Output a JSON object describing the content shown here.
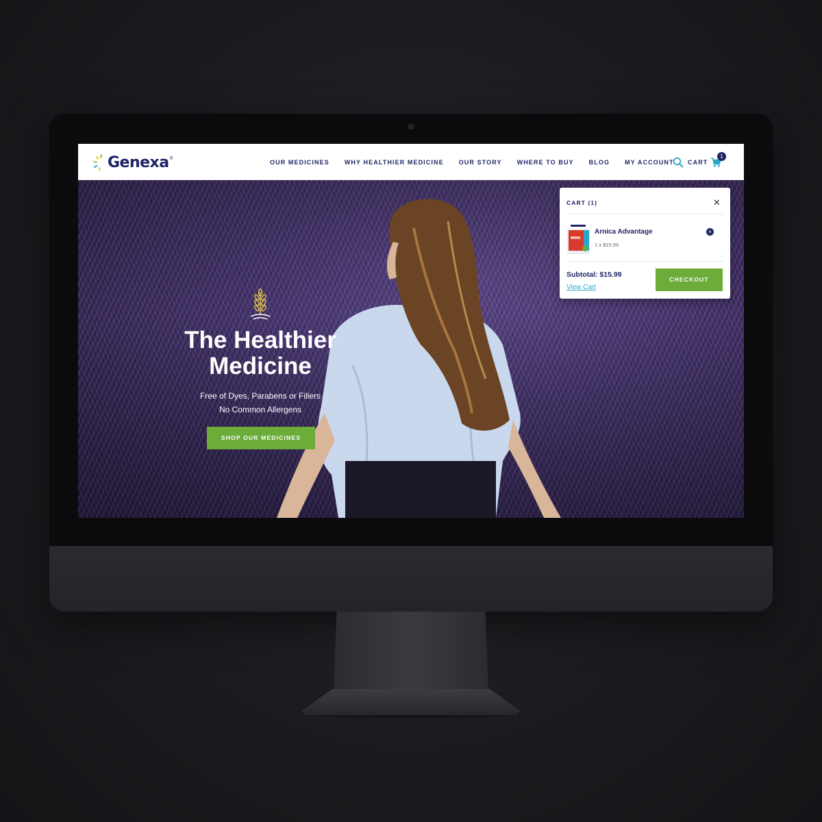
{
  "brand": {
    "name": "Genexa",
    "registered_mark": "®",
    "primary_color": "#1f2466",
    "accent_green": "#6cad3a",
    "accent_teal": "#2aa6c9"
  },
  "nav": {
    "items": [
      {
        "label": "OUR MEDICINES"
      },
      {
        "label": "WHY HEALTHIER MEDICINE"
      },
      {
        "label": "OUR STORY"
      },
      {
        "label": "WHERE TO BUY"
      },
      {
        "label": "BLOG"
      },
      {
        "label": "MY ACCOUNT"
      }
    ],
    "search_icon": "search-icon",
    "cart_label": "CART",
    "cart_icon": "shopping-cart-icon",
    "cart_count": "1"
  },
  "hero": {
    "icon": "wheat-icon",
    "title_line1": "The Healthier",
    "title_line2": "Medicine",
    "subtitle_line1": "Free of Dyes, Parabens or Fillers",
    "subtitle_line2": "No Common Allergens",
    "cta_label": "SHOP OUR MEDICINES"
  },
  "cart_popup": {
    "title": "CART (1)",
    "close_icon": "close-icon",
    "item": {
      "name": "Arnica Advantage",
      "qty_price": "1 x $15.99",
      "remove_icon": "remove-icon"
    },
    "subtotal": "Subtotal: $15.99",
    "view_cart_label": "View Cart",
    "checkout_label": "CHECKOUT"
  }
}
